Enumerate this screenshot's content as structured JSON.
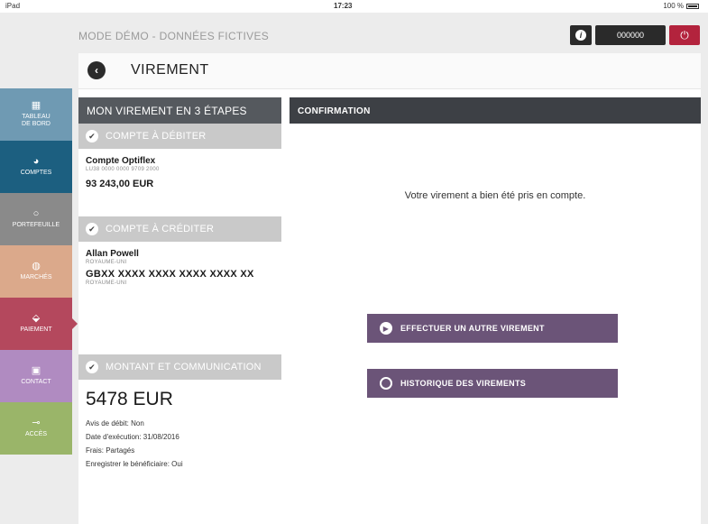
{
  "status_bar": {
    "device": "iPad",
    "time": "17:23",
    "battery": "100 %"
  },
  "header": {
    "demo_label": "MODE DÉMO - DONNÉES FICTIVES",
    "account_number": "000000",
    "page_title": "VIREMENT"
  },
  "sidebar": {
    "items": [
      {
        "label_line1": "TABLEAU",
        "label_line2": "DE BORD",
        "icon": "grid-icon",
        "color": "#6f9ab3"
      },
      {
        "label_line1": "COMPTES",
        "label_line2": "",
        "icon": "pie-chart-icon",
        "color": "#1c5f80"
      },
      {
        "label_line1": "PORTEFEUILLE",
        "label_line2": "",
        "icon": "ring-icon",
        "color": "#8a8a8a"
      },
      {
        "label_line1": "MARCHÉS",
        "label_line2": "",
        "icon": "globe-icon",
        "color": "#dba98b"
      },
      {
        "label_line1": "PAIEMENT",
        "label_line2": "",
        "icon": "payment-icon",
        "color": "#b4485d"
      },
      {
        "label_line1": "CONTACT",
        "label_line2": "",
        "icon": "phone-icon",
        "color": "#b08bc1"
      },
      {
        "label_line1": "ACCÈS",
        "label_line2": "",
        "icon": "key-icon",
        "color": "#9ab569"
      }
    ]
  },
  "steps": {
    "title": "MON VIREMENT EN 3 ÉTAPES",
    "debit": {
      "section_label": "COMPTE À DÉBITER",
      "account_name": "Compte Optiflex",
      "account_iban": "LU38 0000 0000 9709 2000",
      "balance": "93 243,00 EUR"
    },
    "credit": {
      "section_label": "COMPTE À CRÉDITER",
      "beneficiary": "Allan Powell",
      "country": "ROYAUME-UNI",
      "iban": "GBXX XXXX XXXX XXXX XXXX XX",
      "iban_country": "ROYAUME-UNI"
    },
    "amount": {
      "section_label": "MONTANT ET COMMUNICATION",
      "value": "5478 EUR",
      "debit_notice": "Avis de débit: Non",
      "execution_date": "Date d'exécution: 31/08/2016",
      "fees": "Frais: Partagés",
      "save_beneficiary": "Enregistrer le bénéficiaire: Oui"
    }
  },
  "confirmation": {
    "title": "CONFIRMATION",
    "message": "Votre virement a bien été pris en compte.",
    "new_transfer_label": "EFFECTUER UN AUTRE VIREMENT",
    "history_label": "HISTORIQUE DES VIREMENTS"
  }
}
